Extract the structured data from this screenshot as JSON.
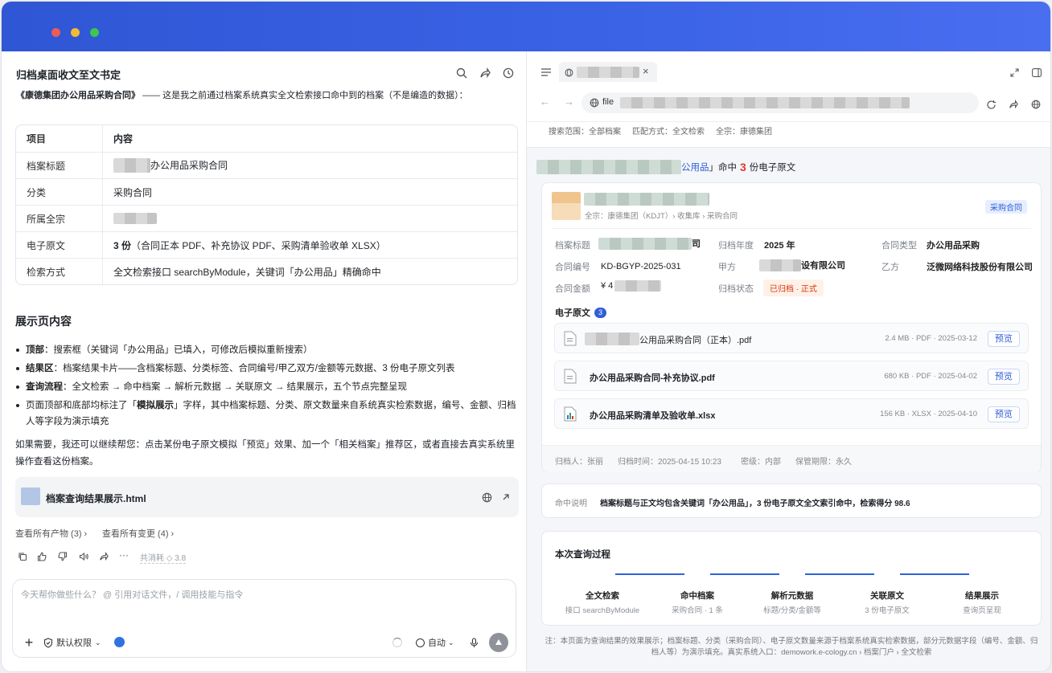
{
  "window": {
    "controls": [
      "close",
      "minimize",
      "maximize"
    ]
  },
  "chat": {
    "title": "归档桌面收文至文书定",
    "intro_doc": "《康德集团办公用品采购合同》",
    "intro_rest": "—— 这是我之前通过档案系统真实全文检索接口命中到的档案（不是编造的数据）：",
    "table": {
      "headers": [
        "项目",
        "内容"
      ],
      "rows": [
        {
          "k": "档案标题",
          "v": "办公用品采购合同"
        },
        {
          "k": "分类",
          "v": "采购合同"
        },
        {
          "k": "所属全宗",
          "v": ""
        },
        {
          "k": "电子原文",
          "v_bold": "3 份",
          "v": "（合同正本 PDF、补充协议 PDF、采购清单验收单 XLSX）"
        },
        {
          "k": "检索方式",
          "v": "全文检索接口 searchByModule，关键词「办公用品」精确命中"
        }
      ]
    },
    "section_title": "展示页内容",
    "points": [
      {
        "b": "顶部",
        "t": "：搜索框（关键词「办公用品」已填入，可修改后模拟重新搜索）"
      },
      {
        "b": "结果区",
        "t": "：档案结果卡片——含档案标题、分类标签、合同编号/甲乙双方/金额等元数据、3 份电子原文列表"
      },
      {
        "b": "查询流程",
        "t": "：全文检索 → 命中档案 → 解析元数据 → 关联原文 → 结果展示，五个节点完整呈现"
      },
      {
        "b": "",
        "t1": "页面顶部和底部均标注了「",
        "b2": "模拟展示",
        "t2": "」字样，其中档案标题、分类、原文数量来自系统真实检索数据，编号、金额、归档人等字段为演示填充"
      }
    ],
    "followup": "如果需要，我还可以继续帮您：点击某份电子原文模拟「预览」效果、加一个「相关档案」推荐区，或者直接去真实系统里操作查看这份档案。",
    "artifact": {
      "name": "档案查询结果展示.html"
    },
    "links": {
      "artifacts": "查看所有产物 (3)",
      "changes": "查看所有变更 (4)"
    },
    "usage": "共消耗 ◇ 3.8",
    "input": {
      "placeholder": "今天帮你做些什么？ @ 引用对话文件，/ 调用技能与指令",
      "permission": "默认权限",
      "mode": "自动"
    }
  },
  "browser": {
    "tab_title": "",
    "url": "file",
    "filters": {
      "scope": "搜索范围：全部档案",
      "match": "匹配方式：全文检索",
      "fonds": "全宗：康德集团"
    },
    "summary": {
      "kw_tail": "公用品",
      "mid": "」命中",
      "count": "3",
      "tail": "份电子原文"
    },
    "record": {
      "path": "全宗：康德集团（KDJT）› 收集库 › 采购合同",
      "tag": "采购合同",
      "fields": [
        {
          "l": "档案标题",
          "v": "司"
        },
        {
          "l": "归档年度",
          "v": "2025 年"
        },
        {
          "l": "合同类型",
          "v": "办公用品采购"
        },
        {
          "l": "合同编号",
          "v": "KD-BGYP-2025-031"
        },
        {
          "l": "甲方",
          "v": "设有限公司"
        },
        {
          "l": "乙方",
          "v": "泛微网络科技股份有限公司"
        },
        {
          "l": "合同金额",
          "v": "¥ 4"
        },
        {
          "l": "归档状态",
          "v": "已归档 · 正式"
        }
      ],
      "attach_title": "电子原文",
      "attach_count": "3",
      "files": [
        {
          "name": "公用品采购合同（正本）.pdf",
          "meta": "2.4 MB · PDF · 2025-03-12",
          "btn": "预览",
          "kind": "pdf"
        },
        {
          "name": "办公用品采购合同-补充协议.pdf",
          "meta": "680 KB · PDF · 2025-04-02",
          "btn": "预览",
          "kind": "pdf"
        },
        {
          "name": "办公用品采购清单及验收单.xlsx",
          "meta": "156 KB · XLSX · 2025-04-10",
          "btn": "预览",
          "kind": "xlsx"
        }
      ],
      "footer": {
        "archiver": "归档人：张丽",
        "time": "归档时间：2025-04-15 10:23",
        "secret": "密级：内部",
        "keep": "保管期限：永久"
      }
    },
    "hit": {
      "label": "命中说明",
      "text": "档案标题与正文均包含关键词「办公用品」，3 份电子原文全文索引命中，检索得分 98.6"
    },
    "process": {
      "title": "本次查询过程",
      "steps": [
        {
          "t": "全文检索",
          "s": "接口 searchByModule"
        },
        {
          "t": "命中档案",
          "s": "采购合同 · 1 条"
        },
        {
          "t": "解析元数据",
          "s": "标题/分类/金额等"
        },
        {
          "t": "关联原文",
          "s": "3 份电子原文"
        },
        {
          "t": "结果展示",
          "s": "查询页呈现"
        }
      ]
    },
    "note": "注：本页面为查询结果的效果展示；档案标题、分类（采购合同）、电子原文数量来源于档案系统真实检索数据，部分元数据字段（编号、金额、归档人等）为演示填充。真实系统入口：demowork.e-cology.cn › 档案门户 › 全文检索"
  }
}
